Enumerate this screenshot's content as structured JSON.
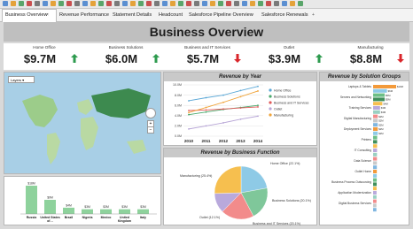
{
  "tabs": [
    {
      "label": "Business Overview",
      "active": true
    },
    {
      "label": "Revenue Performance",
      "active": false
    },
    {
      "label": "Statement Details",
      "active": false
    },
    {
      "label": "Headcount",
      "active": false
    },
    {
      "label": "Salesforce Pipeline Overview",
      "active": false
    },
    {
      "label": "Salesforce Renewals",
      "active": false
    }
  ],
  "page_title": "Business Overview",
  "kpis": [
    {
      "label": "Home Office",
      "value": "$9.7M",
      "trend": "up"
    },
    {
      "label": "Business Solutions",
      "value": "$6.0M",
      "trend": "up"
    },
    {
      "label": "Business and IT Services",
      "value": "$5.7M",
      "trend": "down"
    },
    {
      "label": "Outlet",
      "value": "$3.9M",
      "trend": "up"
    },
    {
      "label": "Manufacturing",
      "value": "$8.8M",
      "trend": "down"
    }
  ],
  "colors": {
    "up": "#2e9b4f",
    "down": "#d9262b",
    "title_bar": "#bfbfbf",
    "map_water": "#a8cfe6",
    "map_land_dark": "#3d8a4f",
    "map_land_light": "#b9d9a3"
  },
  "map": {
    "layer_select": "Layers",
    "icons": [
      "layers-icon",
      "pan-control-icon",
      "zoom-in-icon",
      "zoom-out-icon"
    ]
  },
  "revenue_by_year": {
    "title": "Revenue by Year",
    "chart_data": {
      "type": "line",
      "x": [
        2010,
        2011,
        2012,
        2013,
        2014
      ],
      "ylim": [
        0,
        10
      ],
      "yticks": [
        "0.0M",
        "2.0M",
        "4.0M",
        "6.0M",
        "8.0M",
        "10.0M"
      ],
      "series": [
        {
          "name": "Home Office",
          "color": "#5aa7d6",
          "values": [
            6.9,
            7.5,
            8.0,
            8.9,
            9.7
          ]
        },
        {
          "name": "Business Solutions",
          "color": "#4aa96c",
          "values": [
            4.2,
            4.7,
            5.2,
            5.6,
            6.0
          ]
        },
        {
          "name": "Business and IT Services",
          "color": "#e05a5a",
          "values": [
            5.0,
            5.1,
            5.3,
            5.5,
            5.7
          ]
        },
        {
          "name": "Outlet",
          "color": "#b7a5d6",
          "values": [
            1.4,
            2.0,
            2.6,
            3.3,
            3.9
          ]
        },
        {
          "name": "Manufacturing",
          "color": "#f0a43a",
          "values": [
            4.6,
            5.6,
            6.6,
            7.7,
            8.8
          ]
        }
      ]
    }
  },
  "revenue_by_function": {
    "title": "Revenue by Business Function",
    "chart_data": {
      "type": "pie",
      "slices": [
        {
          "label": "Home Office (22.1%)",
          "value": 22.1,
          "color": "#8ecae6"
        },
        {
          "label": "Business Solutions (20.1%)",
          "value": 20.1,
          "color": "#7fc79a"
        },
        {
          "label": "Business and IT Services (20.1%)",
          "value": 20.1,
          "color": "#f28b8b"
        },
        {
          "label": "Outlet (12.1%)",
          "value": 12.1,
          "color": "#b9a9dc"
        },
        {
          "label": "Manufacturing (25.4%)",
          "value": 25.4,
          "color": "#f6bf4f"
        }
      ]
    }
  },
  "country_bars": {
    "chart_data": {
      "type": "bar",
      "categories": [
        "Russia",
        "United States of…",
        "Brazil",
        "Nigeria",
        "Mexico",
        "United Kingdom",
        "Italy"
      ],
      "values": [
        18,
        9,
        4,
        3,
        3,
        3,
        3
      ],
      "value_labels": [
        "$18M",
        "$9M",
        "$4M",
        "$3M",
        "$3M",
        "$3M",
        "$3M"
      ],
      "color": "#8ed29c"
    }
  },
  "revenue_by_solution": {
    "title": "Revenue by Solution Groups",
    "chart_data": {
      "type": "bar",
      "orientation": "horizontal",
      "categories": [
        "Laptops & Tablets",
        "Servers and Networking",
        "Training Services",
        "Digital Manufacturing",
        "Deployment Services",
        "Printers",
        "IT Consulting",
        "Data Science",
        "Outlet Home",
        "Business Process Outsourcing",
        "Application Modernization",
        "Digital Business Services"
      ],
      "values": [
        10,
        6,
        5,
        5,
        4,
        3,
        3,
        2,
        2,
        2,
        2,
        2
      ],
      "value_labels": [
        "$10M",
        "$6M",
        "$5M",
        "$5M",
        "$4M",
        "$3M",
        "$3M",
        "$2M",
        "$2M",
        "$2M",
        "$2M",
        "$2M"
      ]
    }
  }
}
